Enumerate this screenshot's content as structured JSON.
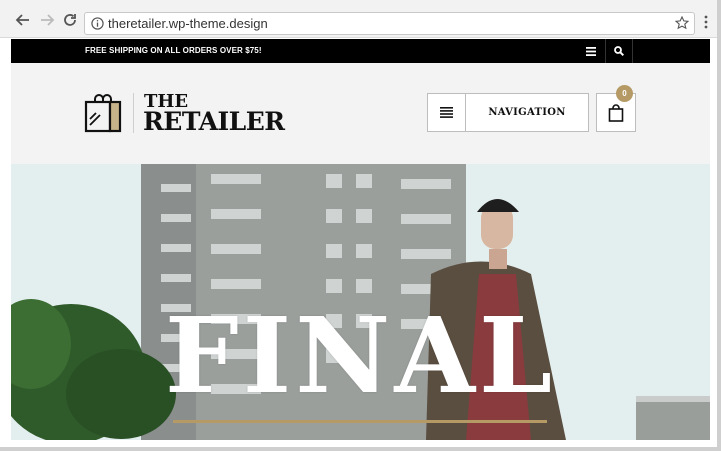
{
  "browser": {
    "url": "theretailer.wp-theme.design",
    "icons": [
      "back-arrow-icon",
      "forward-arrow-icon",
      "reload-icon",
      "info-icon",
      "star-icon",
      "menu-dots-icon"
    ]
  },
  "topbar": {
    "promo": "FREE SHIPPING ON ALL ORDERS OVER $75!",
    "icons": [
      "hamburger-icon",
      "search-icon"
    ]
  },
  "header": {
    "logo_line1": "THE",
    "logo_line2": "RETAILER",
    "nav_label": "NAVIGATION",
    "cart_count": "0"
  },
  "hero": {
    "title": "FINAL"
  },
  "colors": {
    "topbar_bg": "#000000",
    "header_bg": "#f3f3f3",
    "accent_gold": "#b59a66",
    "hero_sky": "#e3eeee"
  }
}
